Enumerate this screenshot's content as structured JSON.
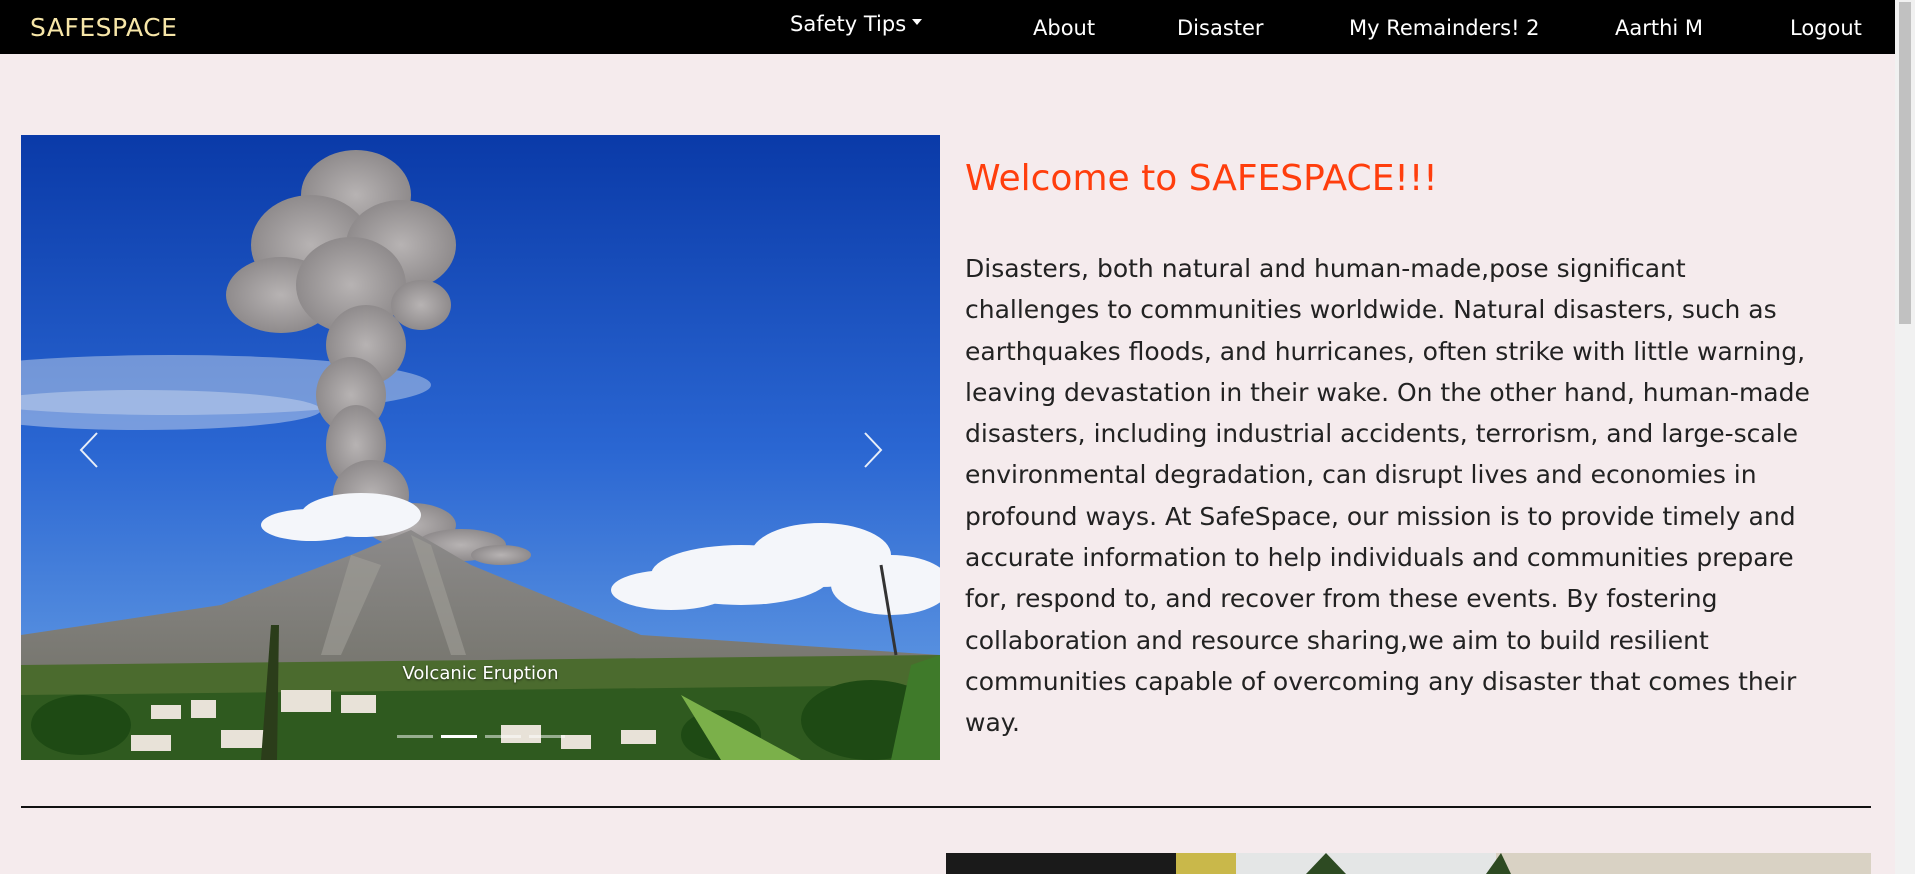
{
  "navbar": {
    "brand": "SAFESPACE",
    "safety_tips": "Safety Tips",
    "about": "About",
    "disaster": "Disaster",
    "reminders": "My Remainders! 2",
    "user": "Aarthi M",
    "logout": "Logout"
  },
  "carousel": {
    "caption": "Volcanic Eruption",
    "slide_count": 4,
    "active_slide": 2
  },
  "main": {
    "welcome_title": "Welcome to SAFESPACE!!!",
    "intro_text": "Disasters, both natural and human-made,pose significant challenges to communities worldwide. Natural disasters, such as earthquakes floods, and hurricanes, often strike with little warning, leaving devastation in their wake. On the other hand, human-made disasters, including industrial accidents, terrorism, and large-scale environmental degradation, can disrupt lives and economies in profound ways. At SafeSpace, our mission is to provide timely and accurate information to help individuals and communities prepare for, respond to, and recover from these events. By fostering collaboration and resource sharing,we aim to build resilient communities capable of overcoming any disaster that comes their way."
  },
  "colors": {
    "background": "#f5ebed",
    "navbar": "#000000",
    "brand": "#f7e6a8",
    "welcome": "#ff3e0d"
  },
  "icons": {
    "prev": "chevron-left-icon",
    "next": "chevron-right-icon",
    "dropdown": "caret-down-icon"
  }
}
